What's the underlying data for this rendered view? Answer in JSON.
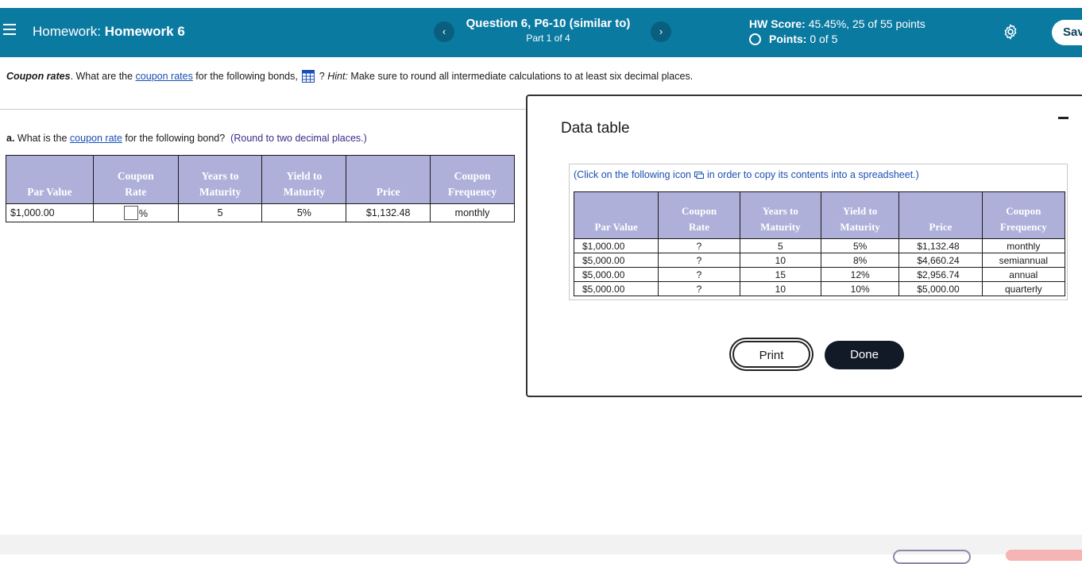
{
  "header": {
    "hw_label": "Homework:",
    "hw_name": "Homework 6",
    "question_title": "Question 6, P6-10 (similar to)",
    "question_part": "Part 1 of 4",
    "prev_symbol": "‹",
    "next_symbol": "›",
    "score_label": "HW Score:",
    "score_value": "45.45%, 25 of 55 points",
    "points_label": "Points:",
    "points_value": "0 of 5",
    "save_label": "Save"
  },
  "question": {
    "topic": "Coupon rates",
    "text1": ". What are the ",
    "link": "coupon rates",
    "text2": " for the following bonds, ",
    "text3": " ? ",
    "hint_label": "Hint:",
    "hint_text": " Make sure to round all intermediate calculations to at least six decimal places."
  },
  "part_a": {
    "label": "a.",
    "text1": " What is the ",
    "link": "coupon rate",
    "text2": " for the following bond?",
    "hint": "(Round to two decimal places.)"
  },
  "left_table": {
    "headers": [
      "Par Value",
      "Coupon Rate",
      "Years to Maturity",
      "Yield to Maturity",
      "Price",
      "Coupon Frequency"
    ],
    "header_lines": [
      [
        "Par Value"
      ],
      [
        "Coupon",
        "Rate"
      ],
      [
        "Years to",
        "Maturity"
      ],
      [
        "Yield to",
        "Maturity"
      ],
      [
        "Price"
      ],
      [
        "Coupon",
        "Frequency"
      ]
    ],
    "row": {
      "par_value": "$1,000.00",
      "coupon_unit": "%",
      "years": "5",
      "yield": "5%",
      "price": "$1,132.48",
      "frequency": "monthly"
    }
  },
  "dialog": {
    "title": "Data table",
    "note_before": "(Click on the following icon",
    "note_after": "in order to copy its contents into a spreadsheet.)",
    "headers": [
      [
        "Par Value"
      ],
      [
        "Coupon",
        "Rate"
      ],
      [
        "Years to",
        "Maturity"
      ],
      [
        "Yield to",
        "Maturity"
      ],
      [
        "Price"
      ],
      [
        "Coupon",
        "Frequency"
      ]
    ],
    "rows": [
      [
        "$1,000.00",
        "?",
        "5",
        "5%",
        "$1,132.48",
        "monthly"
      ],
      [
        "$5,000.00",
        "?",
        "10",
        "8%",
        "$4,660.24",
        "semiannual"
      ],
      [
        "$5,000.00",
        "?",
        "15",
        "12%",
        "$2,956.74",
        "annual"
      ],
      [
        "$5,000.00",
        "?",
        "10",
        "10%",
        "$5,000.00",
        "quarterly"
      ]
    ],
    "print_label": "Print",
    "done_label": "Done"
  }
}
